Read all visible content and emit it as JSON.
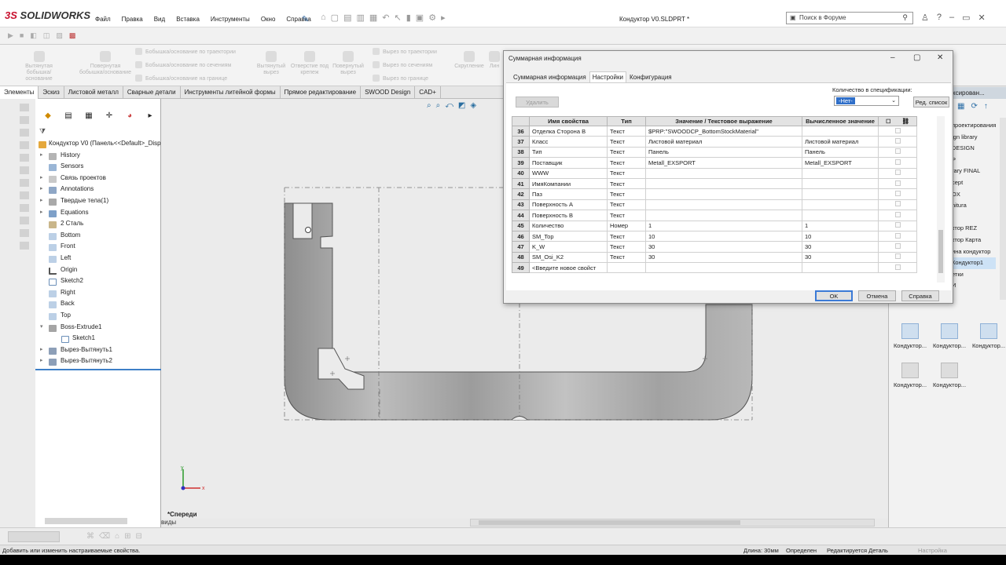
{
  "app": {
    "logo": "SOLIDWORKS",
    "doc_title": "Кондуктор V0.SLDPRT *"
  },
  "menu": [
    "Файл",
    "Правка",
    "Вид",
    "Вставка",
    "Инструменты",
    "Окно",
    "Справка"
  ],
  "search": {
    "placeholder": "Поиск в Форуме"
  },
  "ribbon": {
    "big": [
      "Вытянутая бобышка/основание",
      "Повернутая бобышка/основание",
      "Вытянутый вырез",
      "Отверстие под крепеж",
      "Повернутый вырез",
      "Скругление",
      "Лин"
    ],
    "small": [
      "Бобышка/основание по траектории",
      "Бобышка/основание по сечениям",
      "Бобышка/основание на границе",
      "Вырез по траектории",
      "Вырез по сечениям",
      "Вырез по границе"
    ]
  },
  "tabs": [
    "Элементы",
    "Эскиз",
    "Листовой металл",
    "Сварные детали",
    "Инструменты литейной формы",
    "Прямое редактирование",
    "SWOOD Design",
    "CAD+"
  ],
  "tree": {
    "root": "Кондуктор V0  (Панель<<Default>_Disp",
    "items": [
      "History",
      "Sensors",
      "Связь проектов",
      "Annotations",
      "Твердые тела(1)",
      "Equations",
      "2 Сталь",
      "Bottom",
      "Front",
      "Left",
      "Origin",
      "Sketch2",
      "Right",
      "Back",
      "Top",
      "Boss-Extrude1",
      "Sketch1",
      "Вырез-Вытянуть1",
      "Вырез-Вытянуть2"
    ]
  },
  "viewport": {
    "view_label": "*Спереди",
    "bottom_label": "виды"
  },
  "task_pane": {
    "header": "ксирован...",
    "list": [
      "проектирования",
      "ign library",
      "DESIGN",
      "P",
      "rary FINAL",
      "cept",
      "OX",
      "nitura",
      "",
      "ктор REZ",
      "ктор Карта",
      "ина кондуктор",
      "Кондуктор1",
      "етки",
      "И"
    ],
    "thumbs": [
      "Кондуктор...",
      "Кондуктор...",
      "Кондуктор...",
      "Кондуктор...",
      "Кондуктор..."
    ]
  },
  "status": {
    "left": "Добавить или изменить настраиваемые свойства.",
    "length": "Длина: 30мм",
    "defined": "Определен",
    "editing": "Редактируется Деталь",
    "settings": "Настройка"
  },
  "dialog": {
    "title": "Суммарная информация",
    "tabs": [
      "Суммарная информация",
      "Настройки",
      "Конфигурация"
    ],
    "delete_label": "Удалить",
    "qty_label": "Количество в спецификации:",
    "qty_value": "-Нет-",
    "edit_list": "Ред. список",
    "columns": [
      "",
      "Имя свойства",
      "Тип",
      "Значение / Текстовое выражение",
      "Вычисленное значение",
      ""
    ],
    "rows": [
      [
        "36",
        "Отделка Сторона B",
        "Текст",
        "$PRP:\"SWOODCP_BottomStockMaterial\"",
        ""
      ],
      [
        "37",
        "Класс",
        "Текст",
        "Листовой материал",
        "Листовой материал"
      ],
      [
        "38",
        "Тип",
        "Текст",
        "Панель",
        "Панель"
      ],
      [
        "39",
        "Поставщик",
        "Текст",
        "Metall_EXSPORT",
        "Metall_EXSPORT"
      ],
      [
        "40",
        "WWW",
        "Текст",
        "",
        ""
      ],
      [
        "41",
        "ИмяКомпании",
        "Текст",
        "",
        ""
      ],
      [
        "42",
        "Паз",
        "Текст",
        "",
        ""
      ],
      [
        "43",
        "Поверхность A",
        "Текст",
        "",
        ""
      ],
      [
        "44",
        "Поверхность B",
        "Текст",
        "",
        ""
      ],
      [
        "45",
        "Количество",
        "Номер",
        "1",
        "1"
      ],
      [
        "46",
        "SM_Top",
        "Текст",
        "10",
        "10"
      ],
      [
        "47",
        "K_W",
        "Текст",
        "30",
        "30"
      ],
      [
        "48",
        "SM_Osi_K2",
        "Текст",
        "30",
        "30"
      ],
      [
        "49",
        "<Введите новое свойст",
        "",
        "",
        ""
      ]
    ],
    "ok": "OK",
    "cancel": "Отмена",
    "help": "Справка"
  },
  "colors": {
    "accent": "#3e7fc7",
    "brand": "#c8102e",
    "part_fill": "#a9a9a9"
  }
}
